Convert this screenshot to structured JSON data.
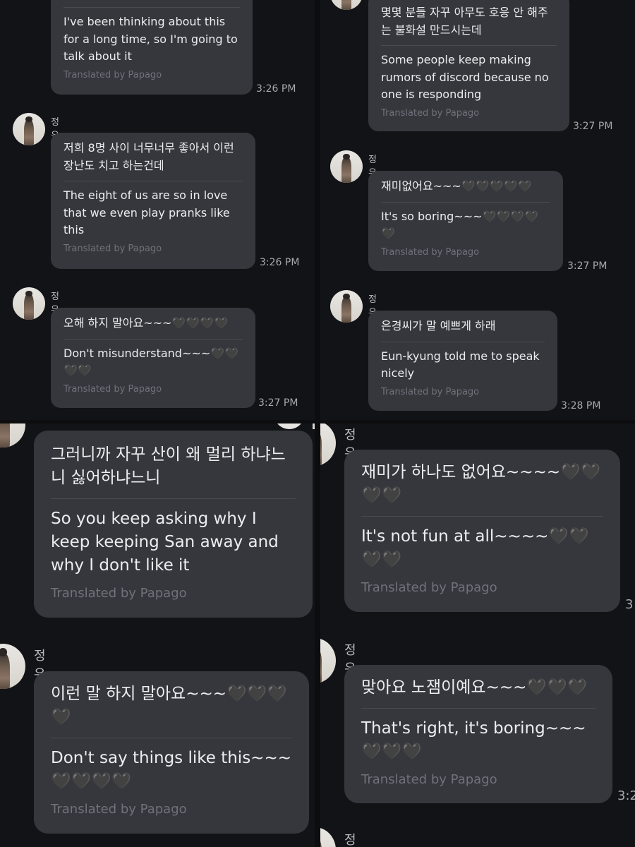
{
  "translator_note": "Translated by Papago",
  "panel_top_left": {
    "msg1": {
      "en": "I've been thinking about this for a long time, so I'm going to talk about it",
      "time": "3:26 PM"
    },
    "msg2": {
      "sender": "정우영",
      "ko": "저희 8명 사이 너무너무 좋아서 이런 장난도 치고 하는건데",
      "en": "The eight of us are so in love that we even play pranks like this",
      "time": "3:26 PM"
    },
    "msg3": {
      "sender": "정우영",
      "ko": "오해 하지 말아요~~~🖤🖤🖤🖤",
      "en": "Don't misunderstand~~~🖤🖤🖤🖤",
      "time": "3:27 PM"
    }
  },
  "panel_top_right": {
    "msg1": {
      "ko": "몇몇 분들  자꾸 아무도 호응 안 해주는 불화설 만드시는데",
      "en": "Some people keep making rumors of discord because no one is responding",
      "time": "3:27 PM"
    },
    "msg2": {
      "sender": "정우영",
      "ko": "재미없어요~~~🖤🖤🖤🖤🖤",
      "en": "It's so boring~~~🖤🖤🖤🖤🖤",
      "time": "3:27 PM"
    },
    "msg3": {
      "sender": "정우영",
      "ko": "은경씨가 말 예쁘게 하래",
      "en": "Eun-kyung told me to speak nicely",
      "time": "3:28 PM"
    }
  },
  "panel_bottom_left": {
    "msg1": {
      "ko": "그러니까 자꾸 산이 왜 멀리 하냐느니 싫어하냐느니",
      "en": "So you keep asking why I keep keeping San away and why I don't like it"
    },
    "msg2": {
      "sender": "정우영",
      "ko": "이런 말 하지 말아요~~~🖤🖤🖤🖤",
      "en": "Don't say things like this~~~🖤🖤🖤🖤"
    }
  },
  "panel_bottom_right": {
    "msg1": {
      "sender": "정우영",
      "ko": "재미가 하나도 없어요~~~~🖤🖤🖤🖤",
      "en": "It's not fun at all~~~~🖤🖤🖤🖤",
      "time": "3"
    },
    "msg2": {
      "sender": "정우영",
      "ko": "맞아요 노잼이예요~~~🖤🖤🖤",
      "en": "That's right, it's boring~~~🖤🖤🖤",
      "time": "3:2"
    },
    "msg3": {
      "sender": "정우영"
    }
  }
}
